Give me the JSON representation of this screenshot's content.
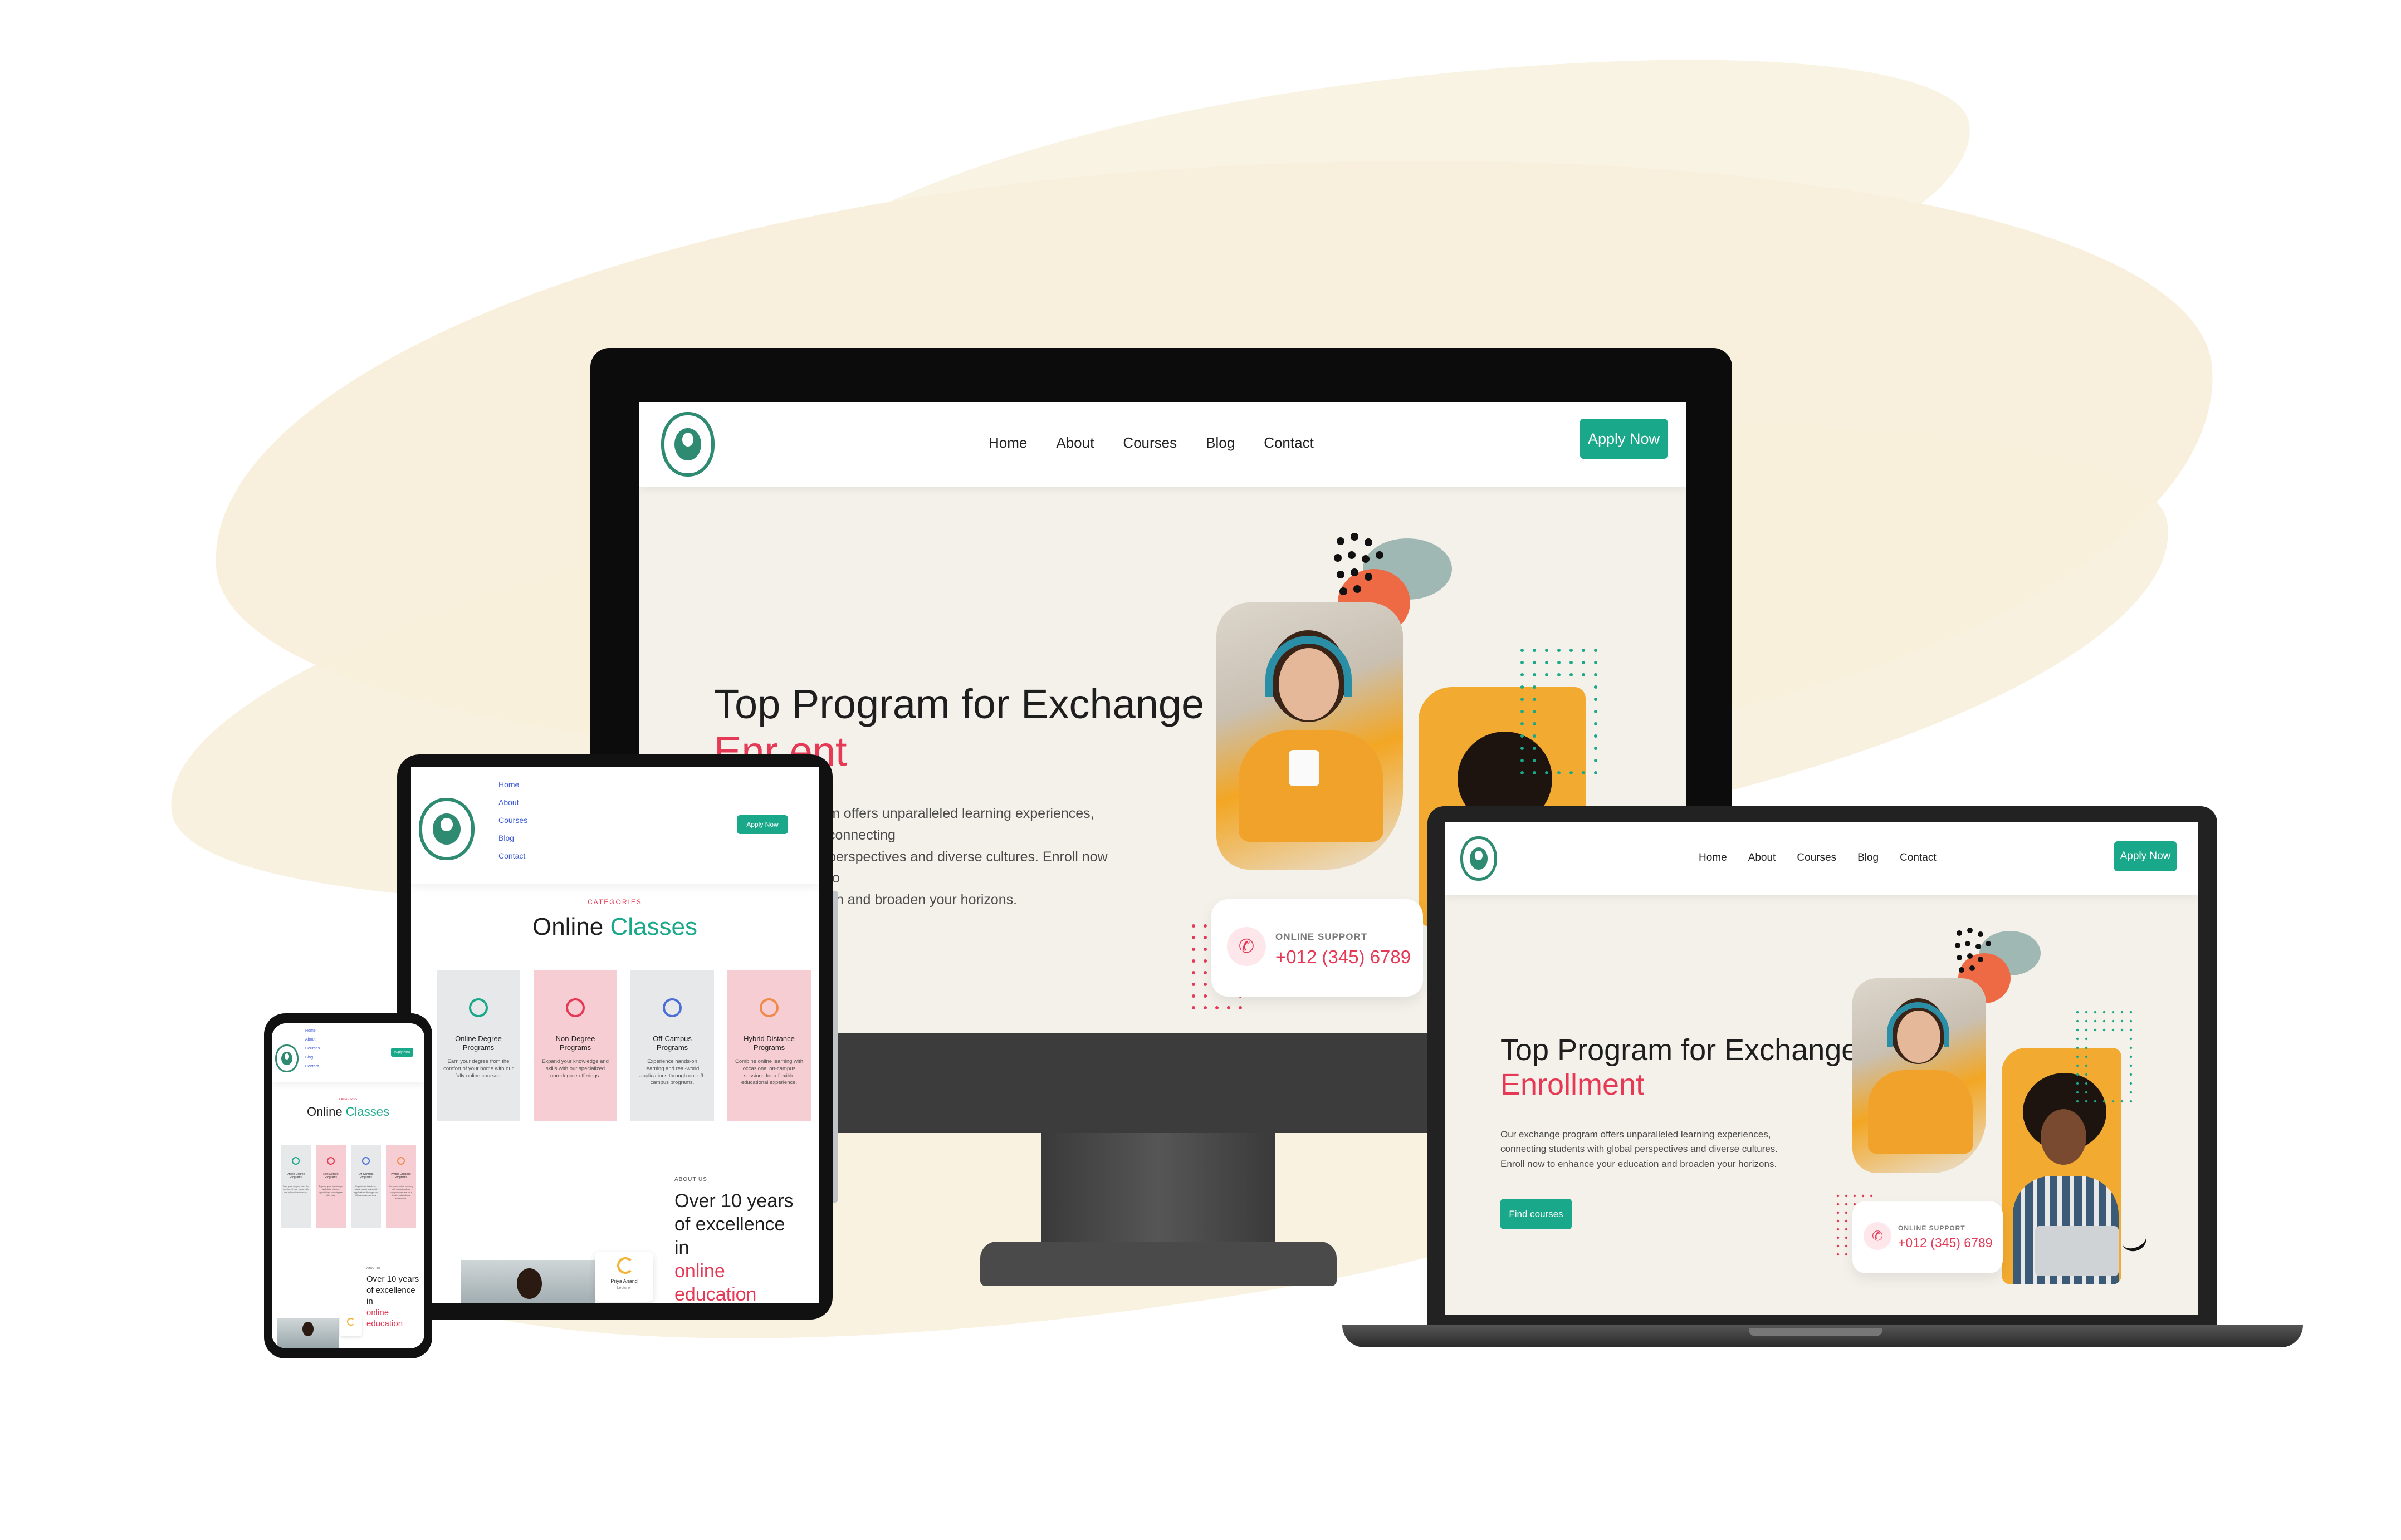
{
  "brand": {
    "accent": "#1aa88a",
    "highlight": "#e53955",
    "logo_green": "#2e8b72",
    "brush": "#f8f0dc"
  },
  "nav": {
    "items": [
      "Home",
      "About",
      "Courses",
      "Blog",
      "Contact"
    ],
    "cta": "Apply Now"
  },
  "hero": {
    "title_line1": "Top Program for Exchange",
    "title_line2": "Enrollment",
    "body": "Our exchange program offers unparalleled learning experiences, connecting students with global perspectives and diverse cultures. Enroll now to enhance your education and broaden your horizons.",
    "monitor_body_line1": "m offers unparalleled learning experiences, connecting",
    "monitor_body_line2": "perspectives and diverse cultures. Enroll now to",
    "monitor_body_line3": "on and broaden your horizons.",
    "monitor_title_line2": "Enr    ent",
    "cta": "Find courses"
  },
  "support": {
    "label": "ONLINE SUPPORT",
    "phone": "+012 (345) 6789"
  },
  "categories": {
    "eyebrow": "CATEGORIES",
    "title_a": "Online",
    "title_b": "Classes",
    "items": [
      {
        "title": "Online Degree Programs",
        "desc": "Earn your degree from the comfort of your home with our fully online courses.",
        "icon": "graduation-icon",
        "bg": "#e6e8ea",
        "ic": "#1aa88a"
      },
      {
        "title": "Non-Degree Programs",
        "desc": "Expand your knowledge and skills with our specialized non-degree offerings.",
        "icon": "certificate-icon",
        "bg": "#f6cdd2",
        "ic": "#e53955"
      },
      {
        "title": "Off-Campus Programs",
        "desc": "Experience hands-on learning and real-world applications through our off-campus programs.",
        "icon": "campus-icon",
        "bg": "#e6e8ea",
        "ic": "#4b6fd6"
      },
      {
        "title": "Hybrid Distance Programs",
        "desc": "Combine online learning with occasional on-campus sessions for a flexible educational experience.",
        "icon": "hybrid-icon",
        "bg": "#f6cdd2",
        "ic": "#f08a4b"
      }
    ]
  },
  "about": {
    "eyebrow": "ABOUT US",
    "line1": "Over 10 years",
    "line2": "of excellence",
    "line3": "in",
    "line4": "online",
    "line5": "education"
  },
  "video_badge": {
    "name": "Priya Anand",
    "role": "Lecturer"
  }
}
